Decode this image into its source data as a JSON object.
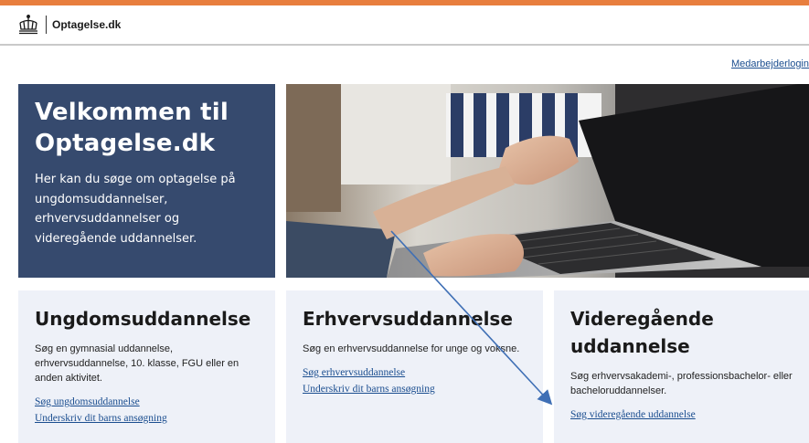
{
  "header": {
    "logo_text": "Optagelse.dk",
    "staff_login": "Medarbejderlogin"
  },
  "hero": {
    "title_line1": "Velkommen til",
    "title_line2": "Optagelse.dk",
    "text": "Her kan du søge om optagelse på ungdomsuddannelser, erhvervsuddannelser og videregående uddannelser."
  },
  "cards": [
    {
      "title": "Ungdomsuddannelse",
      "description": "Søg en gymnasial uddannelse, erhvervsuddannelse, 10. klasse, FGU eller en anden aktivitet.",
      "link1": "Søg ungdomsuddannelse",
      "link2": "Underskriv dit barns ansøgning"
    },
    {
      "title": "Erhvervsuddannelse",
      "description": "Søg en erhvervsuddannelse for unge og voksne.",
      "link1": "Søg erhvervsuddannelse",
      "link2": "Underskriv dit barns ansøgning"
    },
    {
      "title_line1": "Videregående",
      "title_line2": "uddannelse",
      "description": "Søg erhvervsakademi-, professionsbachelor- eller bacheloruddannelser.",
      "link1": "Søg videregående uddannelse"
    }
  ],
  "colors": {
    "accent_bar": "#e87e3e",
    "hero_bg": "#364a6e",
    "card_bg": "#eef1f8",
    "link": "#1a4d8f",
    "annotation_arrow": "#3f6fb5"
  },
  "icons": {
    "logo": "crown-icon",
    "annotation": "arrow-annotation"
  }
}
